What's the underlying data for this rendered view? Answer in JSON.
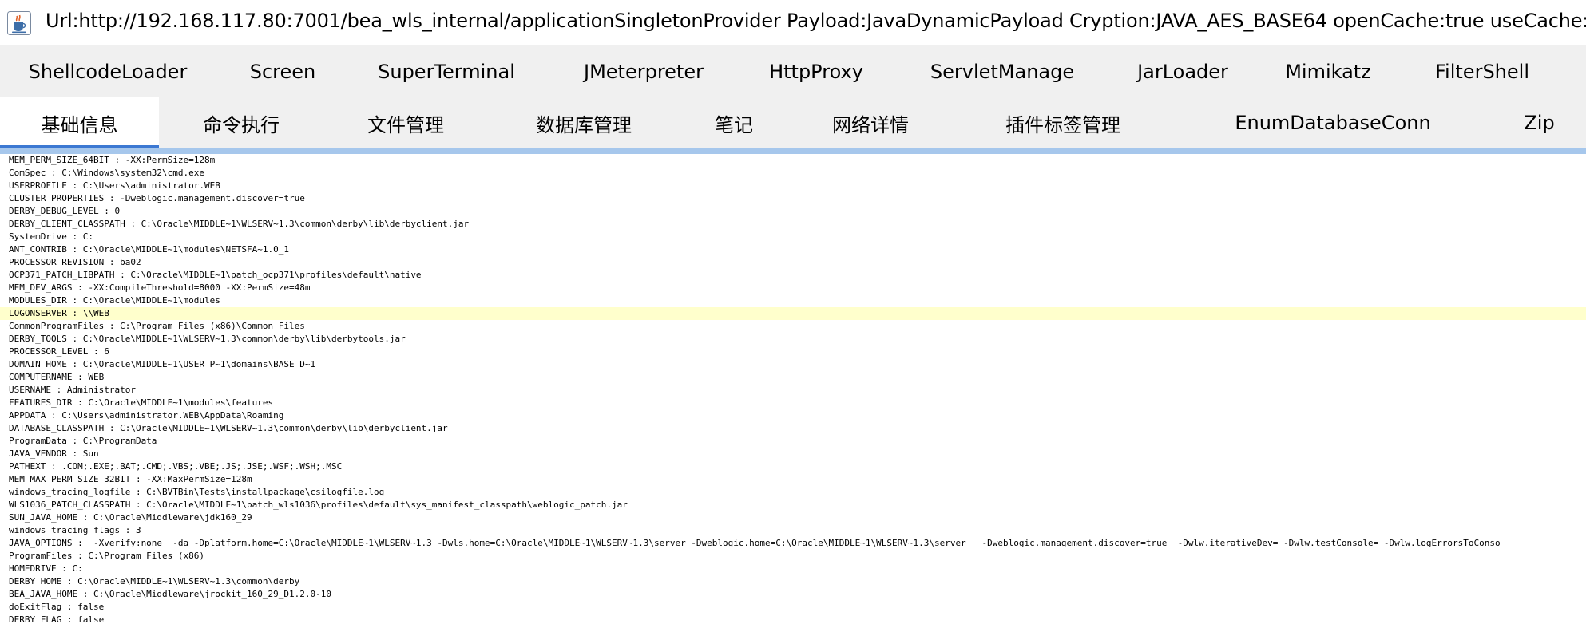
{
  "window": {
    "icon": "java-cup-icon",
    "title": "Url:http://192.168.117.80:7001/bea_wls_internal/applicationSingletonProvider Payload:JavaDynamicPayload Cryption:JAVA_AES_BASE64 openCache:true useCache:false"
  },
  "plugin_tabs": [
    {
      "label": "ShellcodeLoader"
    },
    {
      "label": "Screen"
    },
    {
      "label": "SuperTerminal"
    },
    {
      "label": "JMeterpreter"
    },
    {
      "label": "HttpProxy"
    },
    {
      "label": "ServletManage"
    },
    {
      "label": "JarLoader"
    },
    {
      "label": "Mimikatz"
    },
    {
      "label": "FilterShell"
    }
  ],
  "main_tabs": [
    {
      "label": "基础信息",
      "selected": true
    },
    {
      "label": "命令执行"
    },
    {
      "label": "文件管理"
    },
    {
      "label": "数据库管理"
    },
    {
      "label": "笔记"
    },
    {
      "label": "网络详情"
    },
    {
      "label": "插件标签管理"
    },
    {
      "label": "EnumDatabaseConn"
    },
    {
      "label": "Zip"
    }
  ],
  "colors": {
    "tab_bar_bg": "#f0f0f0",
    "selected_tab_bg": "#ffffff",
    "selected_indicator": "#3c78d2",
    "content_border": "#a6c7ec",
    "highlight_line": "#ffffcc"
  },
  "env_lines": [
    {
      "text": "MEM_PERM_SIZE_64BIT : -XX:PermSize=128m"
    },
    {
      "text": "ComSpec : C:\\Windows\\system32\\cmd.exe"
    },
    {
      "text": "USERPROFILE : C:\\Users\\administrator.WEB"
    },
    {
      "text": "CLUSTER_PROPERTIES : -Dweblogic.management.discover=true"
    },
    {
      "text": "DERBY_DEBUG_LEVEL : 0"
    },
    {
      "text": "DERBY_CLIENT_CLASSPATH : C:\\Oracle\\MIDDLE~1\\WLSERV~1.3\\common\\derby\\lib\\derbyclient.jar"
    },
    {
      "text": "SystemDrive : C:"
    },
    {
      "text": "ANT_CONTRIB : C:\\Oracle\\MIDDLE~1\\modules\\NETSFA~1.0_1"
    },
    {
      "text": "PROCESSOR_REVISION : ba02"
    },
    {
      "text": "OCP371_PATCH_LIBPATH : C:\\Oracle\\MIDDLE~1\\patch_ocp371\\profiles\\default\\native"
    },
    {
      "text": "MEM_DEV_ARGS : -XX:CompileThreshold=8000 -XX:PermSize=48m"
    },
    {
      "text": "MODULES_DIR : C:\\Oracle\\MIDDLE~1\\modules"
    },
    {
      "text": "LOGONSERVER : \\\\WEB",
      "highlight": true
    },
    {
      "text": "CommonProgramFiles : C:\\Program Files (x86)\\Common Files"
    },
    {
      "text": "DERBY_TOOLS : C:\\Oracle\\MIDDLE~1\\WLSERV~1.3\\common\\derby\\lib\\derbytools.jar"
    },
    {
      "text": "PROCESSOR_LEVEL : 6"
    },
    {
      "text": "DOMAIN_HOME : C:\\Oracle\\MIDDLE~1\\USER_P~1\\domains\\BASE_D~1"
    },
    {
      "text": "COMPUTERNAME : WEB"
    },
    {
      "text": "USERNAME : Administrator"
    },
    {
      "text": "FEATURES_DIR : C:\\Oracle\\MIDDLE~1\\modules\\features"
    },
    {
      "text": "APPDATA : C:\\Users\\administrator.WEB\\AppData\\Roaming"
    },
    {
      "text": "DATABASE_CLASSPATH : C:\\Oracle\\MIDDLE~1\\WLSERV~1.3\\common\\derby\\lib\\derbyclient.jar"
    },
    {
      "text": "ProgramData : C:\\ProgramData"
    },
    {
      "text": "JAVA_VENDOR : Sun"
    },
    {
      "text": "PATHEXT : .COM;.EXE;.BAT;.CMD;.VBS;.VBE;.JS;.JSE;.WSF;.WSH;.MSC"
    },
    {
      "text": "MEM_MAX_PERM_SIZE_32BIT : -XX:MaxPermSize=128m"
    },
    {
      "text": "windows_tracing_logfile : C:\\BVTBin\\Tests\\installpackage\\csilogfile.log"
    },
    {
      "text": "WLS1036_PATCH_CLASSPATH : C:\\Oracle\\MIDDLE~1\\patch_wls1036\\profiles\\default\\sys_manifest_classpath\\weblogic_patch.jar"
    },
    {
      "text": "SUN_JAVA_HOME : C:\\Oracle\\Middleware\\jdk160_29"
    },
    {
      "text": "windows_tracing_flags : 3"
    },
    {
      "text": "JAVA_OPTIONS :  -Xverify:none  -da -Dplatform.home=C:\\Oracle\\MIDDLE~1\\WLSERV~1.3 -Dwls.home=C:\\Oracle\\MIDDLE~1\\WLSERV~1.3\\server -Dweblogic.home=C:\\Oracle\\MIDDLE~1\\WLSERV~1.3\\server   -Dweblogic.management.discover=true  -Dwlw.iterativeDev= -Dwlw.testConsole= -Dwlw.logErrorsToConso"
    },
    {
      "text": "ProgramFiles : C:\\Program Files (x86)"
    },
    {
      "text": "HOMEDRIVE : C:"
    },
    {
      "text": "DERBY_HOME : C:\\Oracle\\MIDDLE~1\\WLSERV~1.3\\common\\derby"
    },
    {
      "text": "BEA_JAVA_HOME : C:\\Oracle\\Middleware\\jrockit_160_29_D1.2.0-10"
    },
    {
      "text": "doExitFlag : false"
    },
    {
      "text": "DERBY_FLAG : false"
    }
  ]
}
